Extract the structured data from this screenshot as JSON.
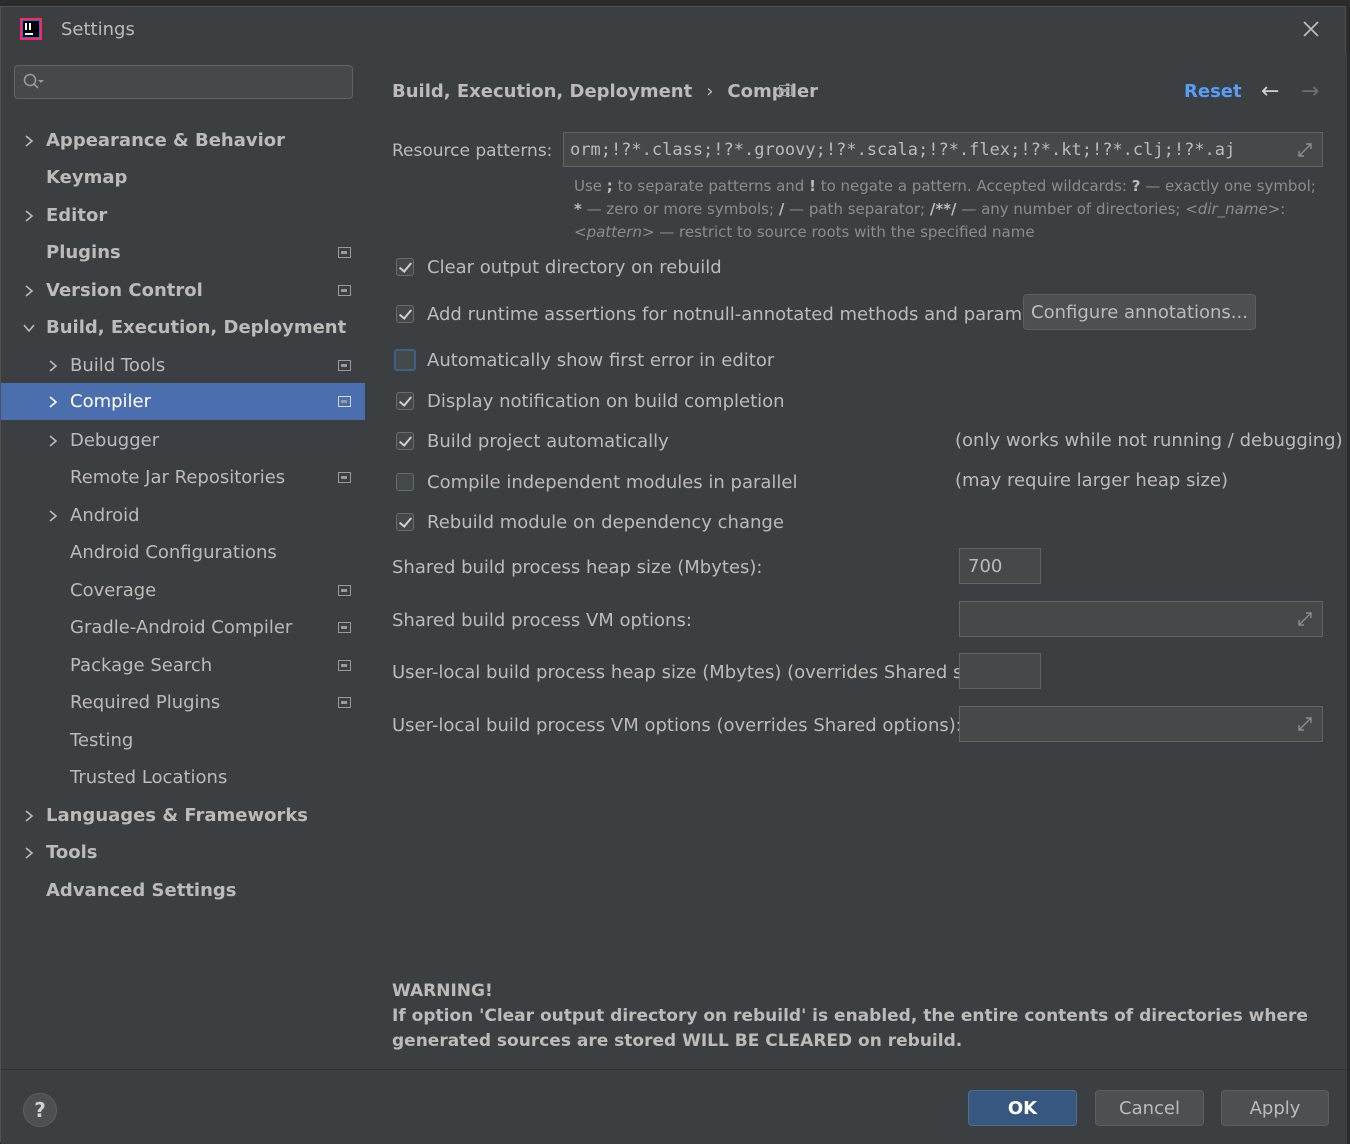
{
  "window": {
    "title": "Settings"
  },
  "sidebar": {
    "search": {
      "value": "",
      "placeholder": ""
    },
    "items": [
      {
        "label": "Appearance & Behavior"
      },
      {
        "label": "Keymap"
      },
      {
        "label": "Editor"
      },
      {
        "label": "Plugins"
      },
      {
        "label": "Version Control"
      },
      {
        "label": "Build, Execution, Deployment"
      },
      {
        "label": "Build Tools"
      },
      {
        "label": "Compiler"
      },
      {
        "label": "Debugger"
      },
      {
        "label": "Remote Jar Repositories"
      },
      {
        "label": "Android"
      },
      {
        "label": "Android Configurations"
      },
      {
        "label": "Coverage"
      },
      {
        "label": "Gradle-Android Compiler"
      },
      {
        "label": "Package Search"
      },
      {
        "label": "Required Plugins"
      },
      {
        "label": "Testing"
      },
      {
        "label": "Trusted Locations"
      },
      {
        "label": "Languages & Frameworks"
      },
      {
        "label": "Tools"
      },
      {
        "label": "Advanced Settings"
      }
    ]
  },
  "header": {
    "breadcrumb_parent": "Build, Execution, Deployment",
    "breadcrumb_sep": "›",
    "breadcrumb_current": "Compiler",
    "reset": "Reset",
    "back": "←",
    "forward": "→"
  },
  "compiler": {
    "resource_patterns_label": "Resource patterns:",
    "resource_patterns_value": "orm;!?*.class;!?*.groovy;!?*.scala;!?*.flex;!?*.kt;!?*.clj;!?*.aj",
    "hint_line1_a": "Use ",
    "hint_semicolon": ";",
    "hint_line1_b": " to separate patterns and ",
    "hint_bang": "!",
    "hint_line1_c": " to negate a pattern. Accepted wildcards: ",
    "hint_q": "?",
    "hint_line1_d": " — exactly one symbol;",
    "hint_star": "*",
    "hint_line2_a": " — zero or more symbols; ",
    "hint_slash": "/",
    "hint_line2_b": " — path separator; ",
    "hint_dstar": "/**/",
    "hint_line2_c": " — any number of directories; ",
    "hint_dirname": "<dir_name>",
    "hint_line2_d": ":",
    "hint_pattern": "<pattern>",
    "hint_line3": " — restrict to source roots with the specified name",
    "options": [
      {
        "label": "Clear output directory on rebuild",
        "checked": true
      },
      {
        "label": "Add runtime assertions for notnull-annotated methods and parameters",
        "checked": true
      },
      {
        "label": "Automatically show first error in editor",
        "checked": false
      },
      {
        "label": "Display notification on build completion",
        "checked": true
      },
      {
        "label": "Build project automatically",
        "checked": true
      },
      {
        "label": "Compile independent modules in parallel",
        "checked": false
      },
      {
        "label": "Rebuild module on dependency change",
        "checked": true
      }
    ],
    "configure_annotations": "Configure annotations...",
    "note_build_auto": "(only works while not running / debugging)",
    "note_parallel": "(may require larger heap size)",
    "shared_heap_label": "Shared build process heap size (Mbytes):",
    "shared_heap_value": "700",
    "shared_vm_label": "Shared build process VM options:",
    "shared_vm_value": "",
    "user_heap_label": "User-local build process heap size (Mbytes) (overrides Shared size):",
    "user_heap_value": "",
    "user_vm_label": "User-local build process VM options (overrides Shared options):",
    "user_vm_value": "",
    "warning_title": "WARNING!",
    "warning_text": "If option 'Clear output directory on rebuild' is enabled, the entire contents of directories where generated sources are stored WILL BE CLEARED on rebuild."
  },
  "footer": {
    "help": "?",
    "ok": "OK",
    "cancel": "Cancel",
    "apply": "Apply"
  },
  "colors": {
    "background": "#3c3f41",
    "selection": "#4b6eaf",
    "link": "#589df6",
    "primary_button": "#365880"
  }
}
